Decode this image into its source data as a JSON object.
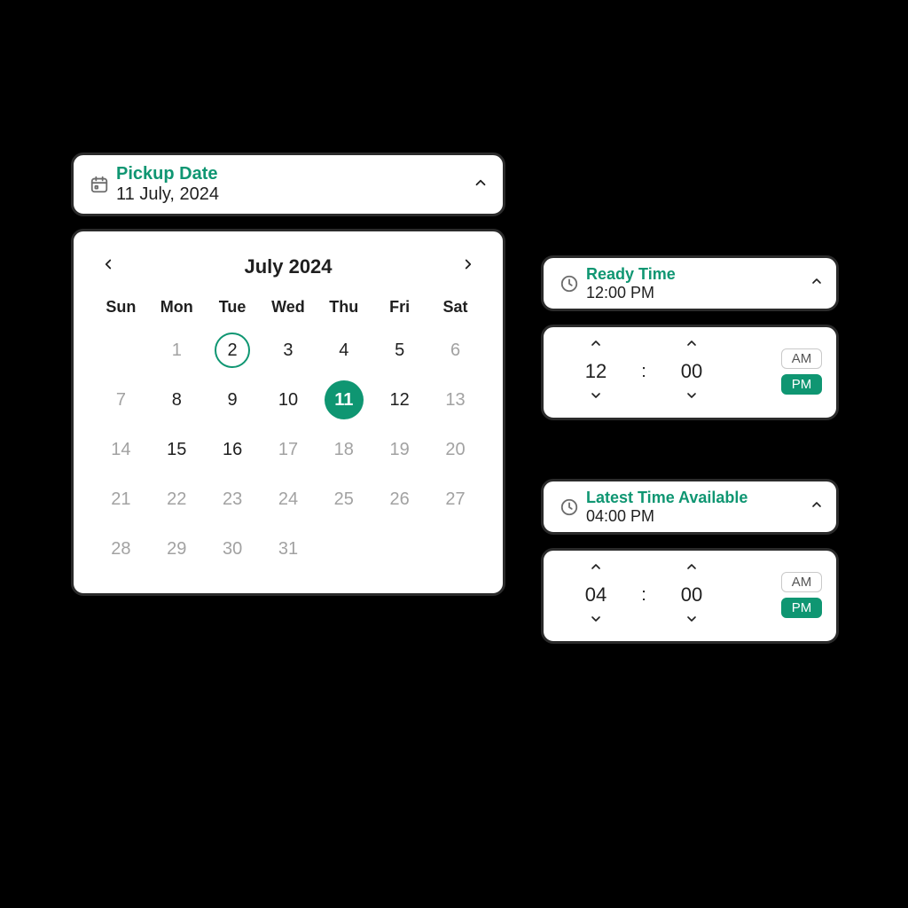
{
  "pickup": {
    "label": "Pickup Date",
    "value": "11 July, 2024"
  },
  "calendar": {
    "title": "July 2024",
    "dow": [
      "Sun",
      "Mon",
      "Tue",
      "Wed",
      "Thu",
      "Fri",
      "Sat"
    ],
    "weeks": [
      [
        {
          "n": "",
          "off": true
        },
        {
          "n": "1",
          "off": true
        },
        {
          "n": "2",
          "today": true
        },
        {
          "n": "3"
        },
        {
          "n": "4"
        },
        {
          "n": "5"
        },
        {
          "n": "6",
          "off": true
        }
      ],
      [
        {
          "n": "7",
          "off": true
        },
        {
          "n": "8"
        },
        {
          "n": "9"
        },
        {
          "n": "10"
        },
        {
          "n": "11",
          "selected": true
        },
        {
          "n": "12"
        },
        {
          "n": "13",
          "off": true
        }
      ],
      [
        {
          "n": "14",
          "off": true
        },
        {
          "n": "15"
        },
        {
          "n": "16"
        },
        {
          "n": "17",
          "off": true
        },
        {
          "n": "18",
          "off": true
        },
        {
          "n": "19",
          "off": true
        },
        {
          "n": "20",
          "off": true
        }
      ],
      [
        {
          "n": "21",
          "off": true
        },
        {
          "n": "22",
          "off": true
        },
        {
          "n": "23",
          "off": true
        },
        {
          "n": "24",
          "off": true
        },
        {
          "n": "25",
          "off": true
        },
        {
          "n": "26",
          "off": true
        },
        {
          "n": "27",
          "off": true
        }
      ],
      [
        {
          "n": "28",
          "off": true
        },
        {
          "n": "29",
          "off": true
        },
        {
          "n": "30",
          "off": true
        },
        {
          "n": "31",
          "off": true
        },
        {
          "n": "",
          "off": true
        },
        {
          "n": "",
          "off": true
        },
        {
          "n": "",
          "off": true
        }
      ]
    ]
  },
  "ready": {
    "label": "Ready Time",
    "value": "12:00 PM",
    "hour": "12",
    "minute": "00",
    "am": "AM",
    "pm": "PM",
    "meridiem": "PM"
  },
  "latest": {
    "label": "Latest Time Available",
    "value": "04:00 PM",
    "hour": "04",
    "minute": "00",
    "am": "AM",
    "pm": "PM",
    "meridiem": "PM"
  },
  "colors": {
    "accent": "#0f9672"
  }
}
